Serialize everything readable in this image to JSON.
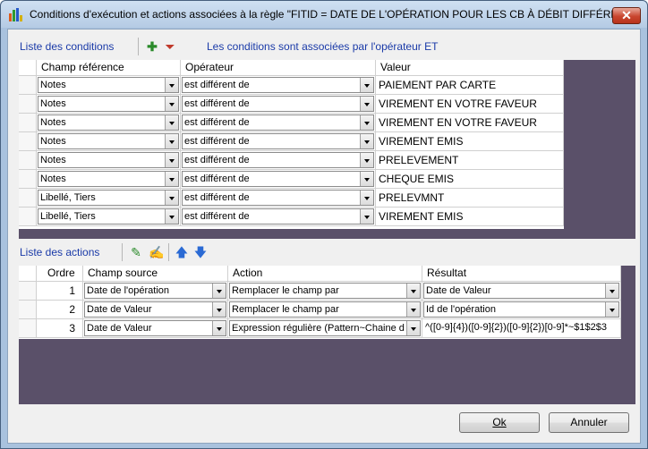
{
  "window": {
    "title": "Conditions d'exécution et actions associées à la règle \"FITID = DATE DE L'OPÉRATION POUR LES CB À DÉBIT DIFFÉRÉ\"",
    "close_label": "✕"
  },
  "conditions": {
    "section_title": "Liste des conditions",
    "info_text": "Les conditions sont associées par l'opérateur ET",
    "columns": [
      "Champ référence",
      "Opérateur",
      "Valeur"
    ],
    "rows": [
      {
        "champ": "Notes",
        "operateur": "est différent de",
        "valeur": "PAIEMENT PAR CARTE"
      },
      {
        "champ": "Notes",
        "operateur": "est différent de",
        "valeur": "VIREMENT EN VOTRE FAVEUR"
      },
      {
        "champ": "Notes",
        "operateur": "est différent de",
        "valeur": "VIREMENT EN VOTRE FAVEUR"
      },
      {
        "champ": "Notes",
        "operateur": "est différent de",
        "valeur": "VIREMENT EMIS"
      },
      {
        "champ": "Notes",
        "operateur": "est différent de",
        "valeur": "PRELEVEMENT"
      },
      {
        "champ": "Notes",
        "operateur": "est différent de",
        "valeur": "CHEQUE EMIS"
      },
      {
        "champ": "Libellé, Tiers",
        "operateur": "est différent de",
        "valeur": "PRELEVMNT"
      },
      {
        "champ": "Libellé, Tiers",
        "operateur": "est différent de",
        "valeur": "VIREMENT EMIS"
      }
    ]
  },
  "actions": {
    "section_title": "Liste des actions",
    "columns": [
      "Ordre",
      "Champ source",
      "Action",
      "Résultat"
    ],
    "rows": [
      {
        "ordre": "1",
        "champ_source": "Date de l'opération",
        "action": "Remplacer le champ par",
        "resultat": "Date de Valeur"
      },
      {
        "ordre": "2",
        "champ_source": "Date de Valeur",
        "action": "Remplacer le champ par",
        "resultat": "Id de l'opération"
      },
      {
        "ordre": "3",
        "champ_source": "Date de Valeur",
        "action": "Expression régulière (Pattern~Chaine d...",
        "resultat": "^([0-9]{4})([0-9]{2})([0-9]{2})[0-9]*~$1$2$3"
      }
    ]
  },
  "buttons": {
    "ok": "Ok",
    "cancel": "Annuler"
  },
  "colors": {
    "accent": "#1a3aa8",
    "grid_background": "#5a5069",
    "title_bar": "#b5cbe4"
  }
}
